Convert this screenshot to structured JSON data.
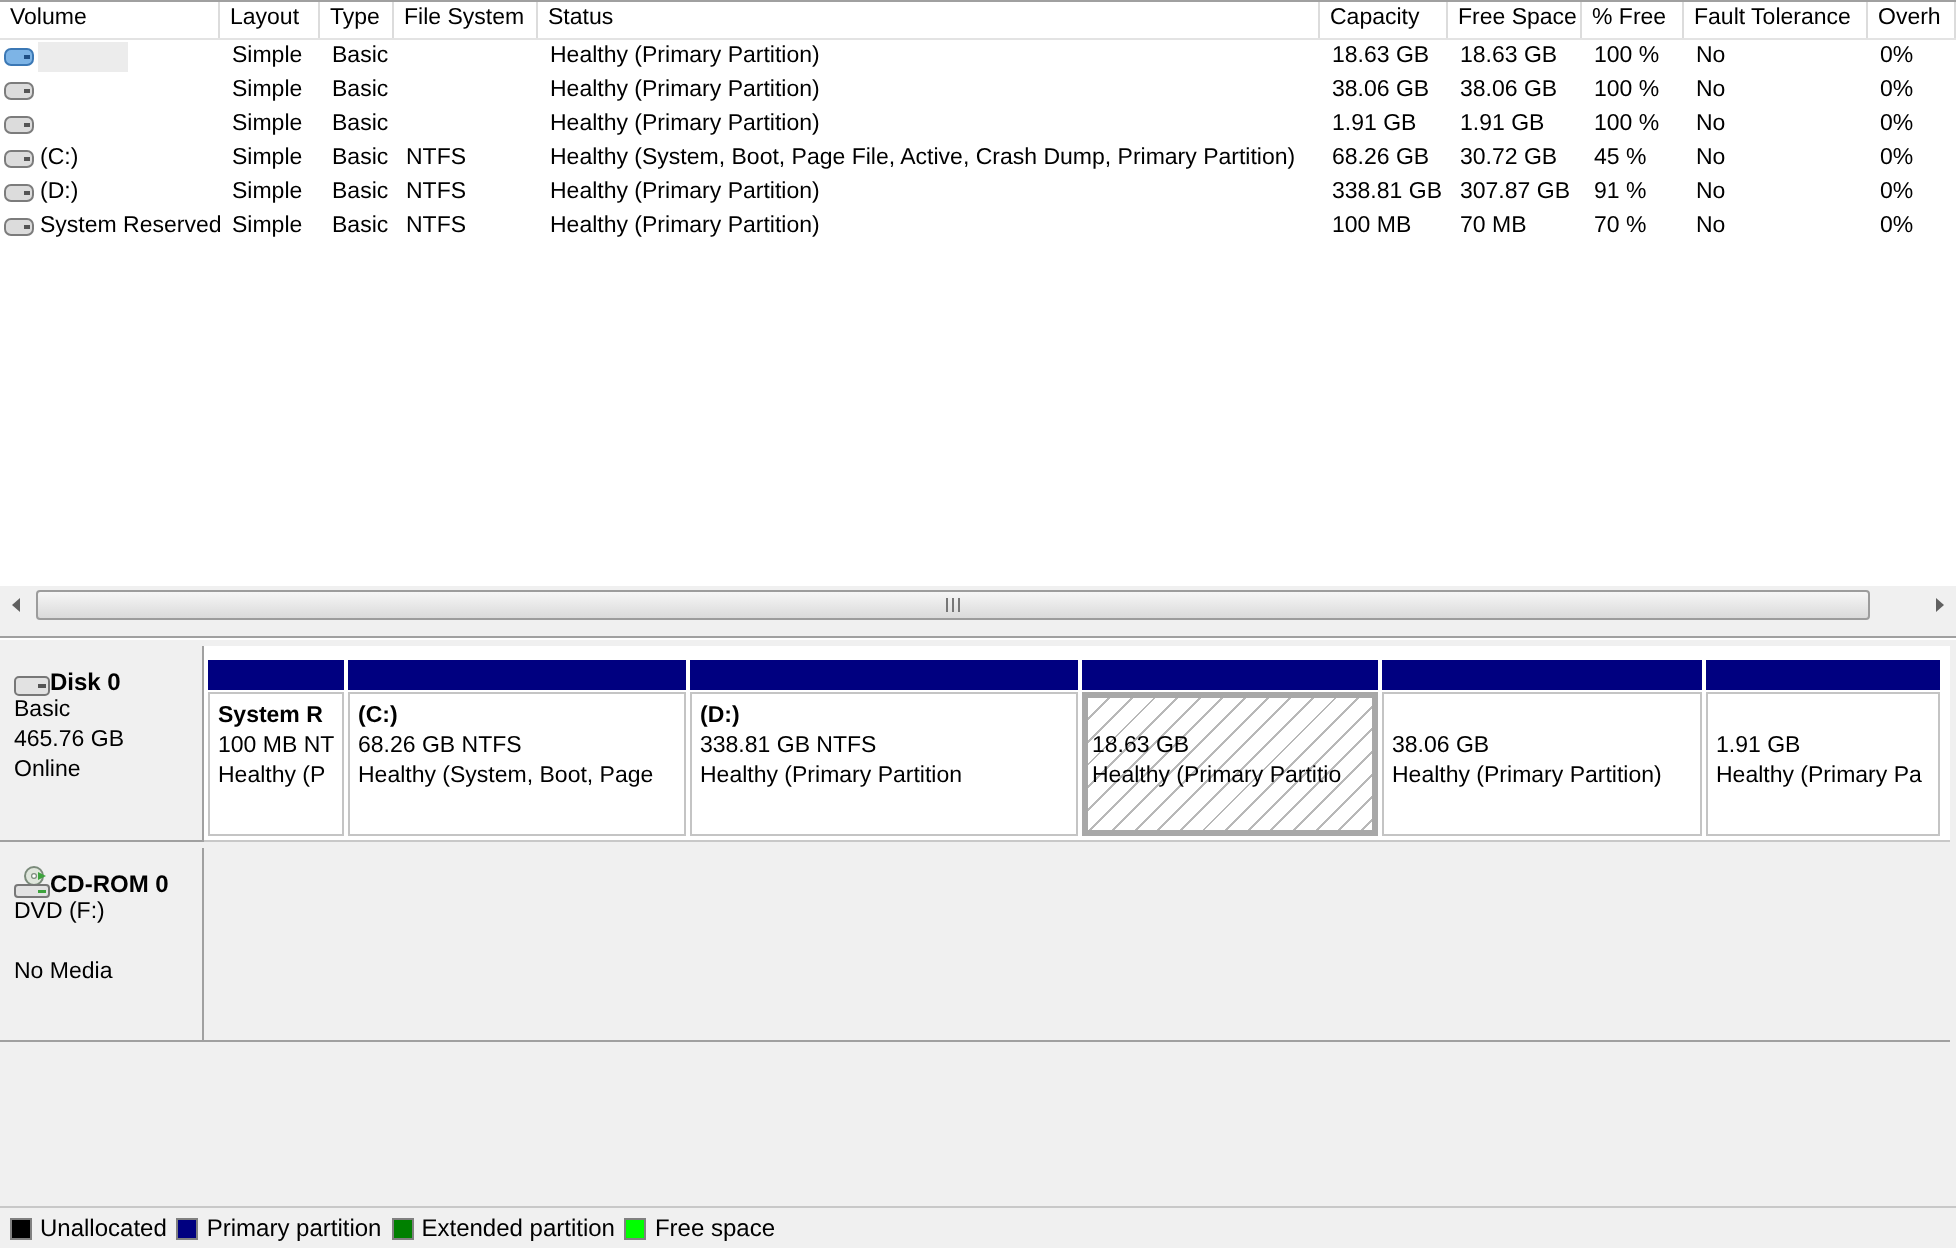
{
  "volume_list": {
    "columns": [
      "Volume",
      "Layout",
      "Type",
      "File System",
      "Status",
      "Capacity",
      "Free Space",
      "% Free",
      "Fault Tolerance",
      "Overh"
    ],
    "rows": [
      {
        "selected": true,
        "layout": "Simple",
        "type": "Basic",
        "status": "Healthy (Primary Partition)",
        "capacity": "18.63 GB",
        "free_space": "18.63 GB",
        "percent_free": "100 %",
        "fault_tolerance": "No",
        "overhead": "0%"
      },
      {
        "selected": false,
        "layout": "Simple",
        "type": "Basic",
        "status": "Healthy (Primary Partition)",
        "capacity": "38.06 GB",
        "free_space": "38.06 GB",
        "percent_free": "100 %",
        "fault_tolerance": "No",
        "overhead": "0%"
      },
      {
        "selected": false,
        "layout": "Simple",
        "type": "Basic",
        "status": "Healthy (Primary Partition)",
        "capacity": "1.91 GB",
        "free_space": "1.91 GB",
        "percent_free": "100 %",
        "fault_tolerance": "No",
        "overhead": "0%"
      },
      {
        "selected": false,
        "volume": "(C:)",
        "layout": "Simple",
        "type": "Basic",
        "file_system": "NTFS",
        "status": "Healthy (System, Boot, Page File, Active, Crash Dump, Primary Partition)",
        "capacity": "68.26 GB",
        "free_space": "30.72 GB",
        "percent_free": "45 %",
        "fault_tolerance": "No",
        "overhead": "0%"
      },
      {
        "selected": false,
        "volume": "(D:)",
        "layout": "Simple",
        "type": "Basic",
        "file_system": "NTFS",
        "status": "Healthy (Primary Partition)",
        "capacity": "338.81 GB",
        "free_space": "307.87 GB",
        "percent_free": "91 %",
        "fault_tolerance": "No",
        "overhead": "0%"
      },
      {
        "selected": false,
        "volume": "System Reserved",
        "layout": "Simple",
        "type": "Basic",
        "file_system": "NTFS",
        "status": "Healthy (Primary Partition)",
        "capacity": "100 MB",
        "free_space": "70 MB",
        "percent_free": "70 %",
        "fault_tolerance": "No",
        "overhead": "0%"
      }
    ]
  },
  "disks": [
    {
      "kind": "disk",
      "name": "Disk 0",
      "type": "Basic",
      "size": "465.76 GB",
      "status": "Online",
      "partitions": [
        {
          "selected": false,
          "label": "System R",
          "size": "100 MB NT",
          "status": "Healthy (P"
        },
        {
          "selected": false,
          "label": "(C:)",
          "size": "68.26 GB NTFS",
          "status": "Healthy (System, Boot, Page"
        },
        {
          "selected": false,
          "label": "(D:)",
          "size": "338.81 GB NTFS",
          "status": "Healthy (Primary Partition"
        },
        {
          "selected": true,
          "size": "18.63 GB",
          "status": "Healthy (Primary Partitio"
        },
        {
          "selected": false,
          "size": "38.06 GB",
          "status": "Healthy (Primary Partition)"
        },
        {
          "selected": false,
          "size": "1.91 GB",
          "status": "Healthy (Primary Pa"
        }
      ]
    },
    {
      "kind": "cdrom",
      "name": "CD-ROM 0",
      "type": "DVD (F:)",
      "status": "No Media"
    }
  ],
  "legend": [
    {
      "label": "Unallocated",
      "color": "#000000"
    },
    {
      "label": "Primary partition",
      "color": "#000080"
    },
    {
      "label": "Extended partition",
      "color": "#008000"
    },
    {
      "label": "Free space",
      "color": "#00ff00"
    }
  ]
}
